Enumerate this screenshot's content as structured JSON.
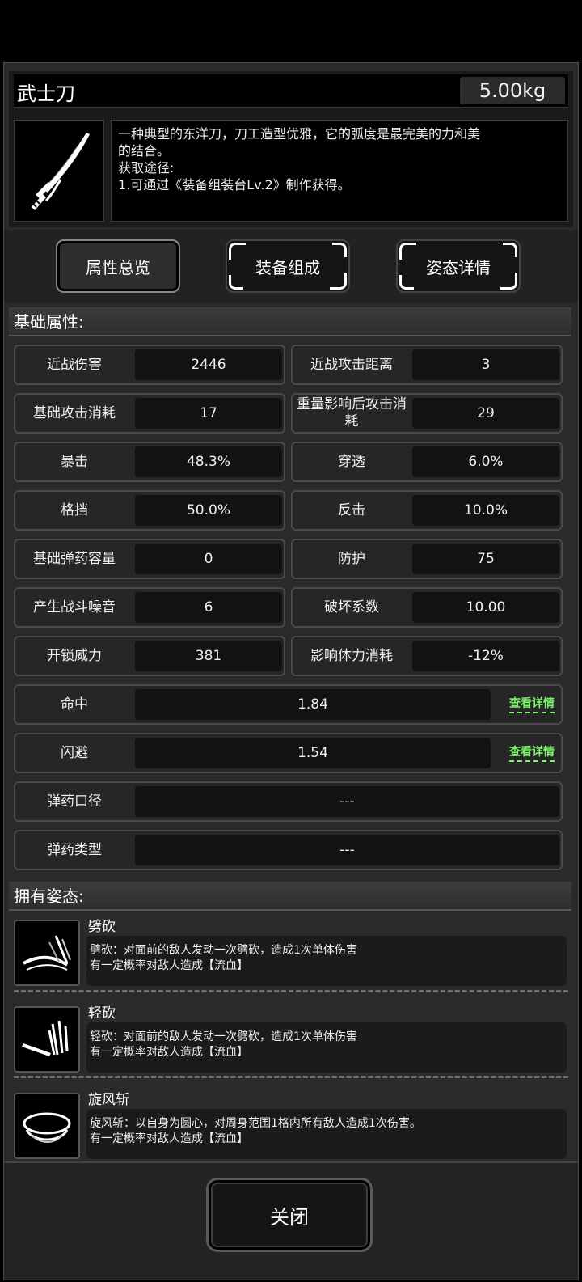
{
  "item": {
    "name": "武士刀",
    "weight": "5.00kg",
    "description_lines": [
      "一种典型的东洋刀，刀工造型优雅，它的弧度是最完美的力和美",
      "的结合。",
      "获取途径:",
      "1.可通过《装备组装台Lv.2》制作获得。"
    ],
    "icon": "katana-icon"
  },
  "tabs": [
    {
      "label": "属性总览",
      "active": true
    },
    {
      "label": "装备组成",
      "active": false
    },
    {
      "label": "姿态详情",
      "active": false
    }
  ],
  "sections": {
    "basic": "基础属性:",
    "stances": "拥有姿态:"
  },
  "stats_pairs": [
    [
      {
        "label": "近战伤害",
        "value": "2446"
      },
      {
        "label": "近战攻击距离",
        "value": "3"
      }
    ],
    [
      {
        "label": "基础攻击消耗",
        "value": "17"
      },
      {
        "label": "重量影响后攻击消耗",
        "value": "29"
      }
    ],
    [
      {
        "label": "暴击",
        "value": "48.3%"
      },
      {
        "label": "穿透",
        "value": "6.0%"
      }
    ],
    [
      {
        "label": "格挡",
        "value": "50.0%"
      },
      {
        "label": "反击",
        "value": "10.0%"
      }
    ],
    [
      {
        "label": "基础弹药容量",
        "value": "0"
      },
      {
        "label": "防护",
        "value": "75"
      }
    ],
    [
      {
        "label": "产生战斗噪音",
        "value": "6"
      },
      {
        "label": "破坏系数",
        "value": "10.00"
      }
    ],
    [
      {
        "label": "开锁威力",
        "value": "381"
      },
      {
        "label": "影响体力消耗",
        "value": "-12%"
      }
    ]
  ],
  "stats_wide": [
    {
      "label": "命中",
      "value": "1.84",
      "link": "查看详情"
    },
    {
      "label": "闪避",
      "value": "1.54",
      "link": "查看详情"
    },
    {
      "label": "弹药口径",
      "value": "---"
    },
    {
      "label": "弹药类型",
      "value": "---"
    }
  ],
  "stances": [
    {
      "name": "劈砍",
      "icon": "slash-icon",
      "desc": [
        "劈砍：对面前的敌人发动一次劈砍，造成1次单体伤害",
        "有一定概率对敌人造成【流血】"
      ]
    },
    {
      "name": "轻砍",
      "icon": "light-slash-icon",
      "desc": [
        "轻砍：对面前的敌人发动一次劈砍，造成1次单体伤害",
        "有一定概率对敌人造成【流血】"
      ]
    },
    {
      "name": "旋风斩",
      "icon": "whirlwind-icon",
      "desc": [
        "旋风斩：以自身为圆心，对周身范围1格内所有敌人造成1次伤害。",
        "有一定概率对敌人造成【流血】"
      ]
    }
  ],
  "footer": {
    "close_label": "关闭"
  }
}
